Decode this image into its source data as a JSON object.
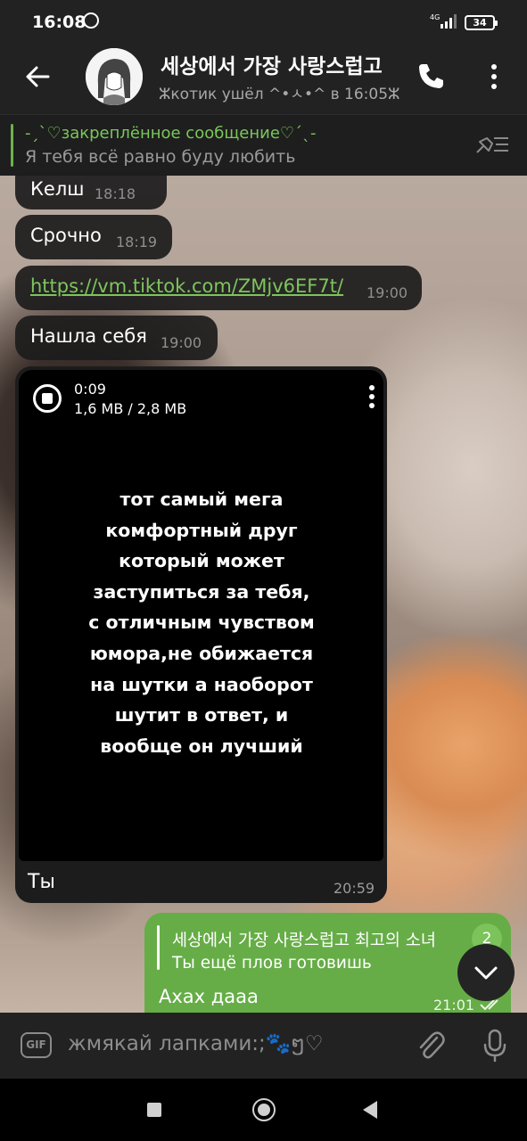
{
  "status_bar": {
    "time": "16:08",
    "network": "4G",
    "battery": "34",
    "icons": [
      "alarm-icon",
      "signal-icon",
      "battery-icon"
    ]
  },
  "header": {
    "title": "세상에서 가장 사랑스럽고",
    "subtitle": "ⵣкотик ушёл ^•ㅅ•^ в 16:05ⵣ",
    "icons": [
      "back-arrow-icon",
      "phone-icon",
      "more-vert-icon"
    ]
  },
  "pinned": {
    "title": "-ˏˋ♡закреплённое сообщение♡ˊˎ-",
    "text": "Я тебя всё равно буду любить",
    "icon": "pin-list-icon"
  },
  "messages": [
    {
      "text": "Келш",
      "time": "18:18"
    },
    {
      "text": "Срочно",
      "time": "18:19"
    },
    {
      "text": "https://vm.tiktok.com/ZMjv6EF7t/",
      "time": "19:00"
    },
    {
      "text": "Нашла себя",
      "time": "19:00"
    }
  ],
  "video_message": {
    "duration": "0:09",
    "size": "1,6 MB / 2,8 MB",
    "overlay_lines": [
      "тот самый мега",
      "комфортный друг",
      "который может",
      "заступиться за тебя,",
      "с отличным чувством",
      "юмора,не обижается",
      "на шутки а наоборот",
      "шутит в ответ, и",
      "вообще он лучший"
    ],
    "caption": "Ты",
    "time": "20:59"
  },
  "outgoing": {
    "reply_name": "세상에서 가장 사랑스럽고 최고의 소녀",
    "reply_text": "Ты ещё плов готовишь",
    "text": "Ахах дааа",
    "time": "21:01"
  },
  "unread_badge": "2",
  "input": {
    "gif_label": "GIF",
    "placeholder": "жмякай лапками:;🐾ໆ♡"
  },
  "colors": {
    "accent_green": "#66ad47",
    "link_green": "#7ec45d",
    "pinned_green": "#7ac75a",
    "bar_bg": "#222222"
  }
}
